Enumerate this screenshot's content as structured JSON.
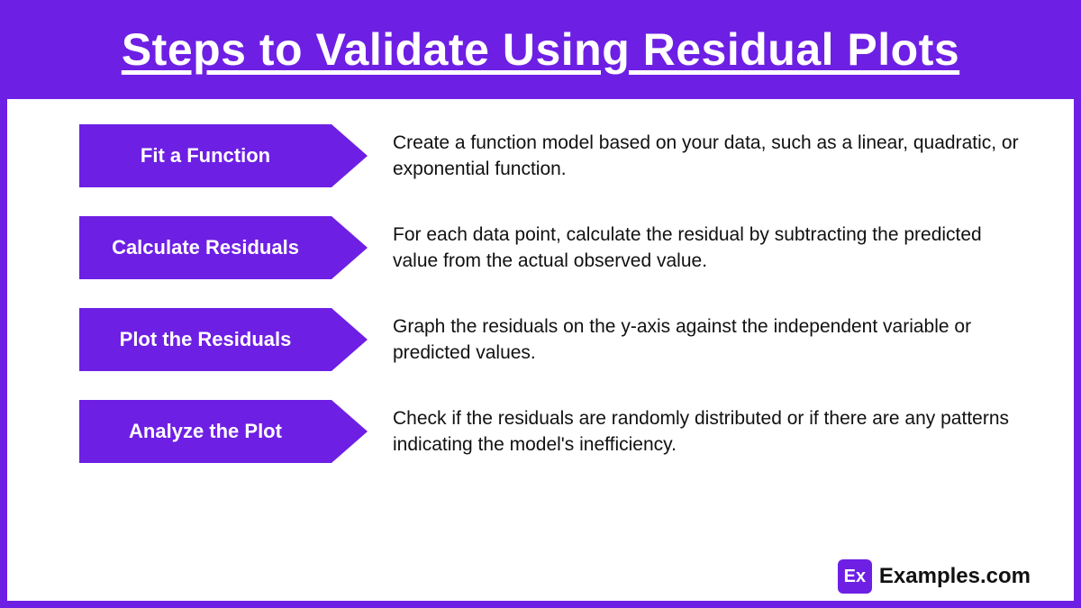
{
  "title": "Steps to Validate Using Residual Plots",
  "steps": [
    {
      "label": "Fit a Function",
      "desc": "Create a function model based on your data, such as a linear, quadratic, or exponential function."
    },
    {
      "label": "Calculate Residuals",
      "desc": "For each data point, calculate the residual by subtracting the predicted value from the actual observed value."
    },
    {
      "label": "Plot the Residuals",
      "desc": "Graph the residuals on the y-axis against the independent variable or predicted values."
    },
    {
      "label": "Analyze the Plot",
      "desc": "Check if the residuals are randomly distributed or if there are any patterns indicating the model's inefficiency."
    }
  ],
  "brand": {
    "short": "Ex",
    "name": "Examples.com"
  }
}
